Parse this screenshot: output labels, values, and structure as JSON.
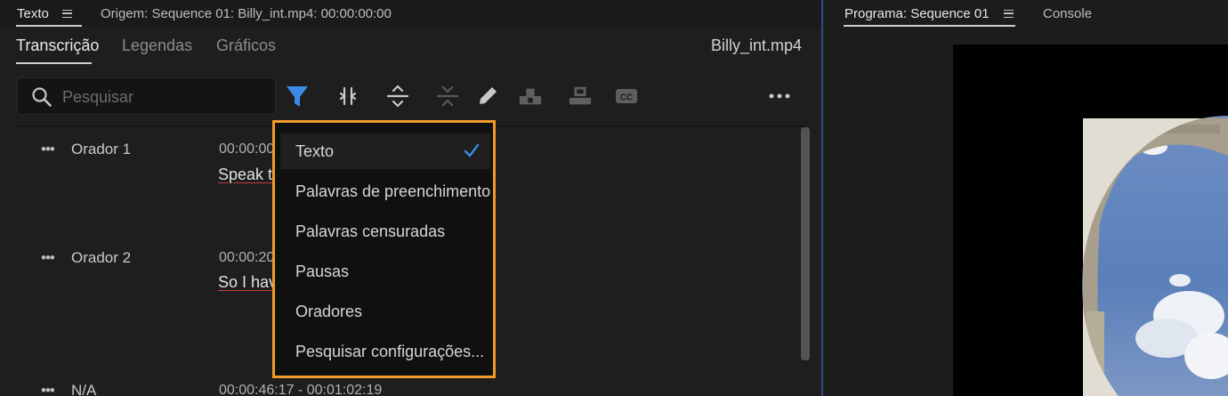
{
  "text_panel": {
    "title": "Texto",
    "source": "Origem: Sequence 01: Billy_int.mp4: 00:00:00:00",
    "tabs": [
      {
        "label": "Transcrição",
        "active": true
      },
      {
        "label": "Legendas",
        "active": false
      },
      {
        "label": "Gráficos",
        "active": false
      }
    ],
    "clip_name": "Billy_int.mp4",
    "search": {
      "placeholder": "Pesquisar",
      "value": ""
    },
    "toolbar_icons": [
      "filter-icon",
      "merge-segments-icon",
      "split-segment-icon",
      "collapse-icon",
      "edit-icon",
      "insert-icon",
      "overwrite-icon",
      "captions-icon",
      "more-options-icon"
    ],
    "rows": [
      {
        "speaker": "Orador 1",
        "timecode": "00:00:00",
        "snippet": "Speak to"
      },
      {
        "speaker": "Orador 2",
        "timecode": "00:00:20",
        "snippet": "So I have"
      },
      {
        "speaker": "N/A",
        "timecode": "00:00:46:17 - 00:01:02:19",
        "snippet": ""
      }
    ]
  },
  "filter_menu": {
    "items": [
      {
        "label": "Texto",
        "checked": true
      },
      {
        "label": "Palavras de preenchimento",
        "checked": false
      },
      {
        "label": "Palavras censuradas",
        "checked": false
      },
      {
        "label": "Pausas",
        "checked": false
      },
      {
        "label": "Oradores",
        "checked": false
      },
      {
        "label": "Pesquisar configurações...",
        "checked": false
      }
    ],
    "highlight_color": "#f09a27",
    "check_color": "#3b8be6"
  },
  "program_panel": {
    "title": "Programa: Sequence 01",
    "console_tab": "Console"
  },
  "colors": {
    "accent_blue": "#3b8be6",
    "panel_border": "#2d4f86",
    "squiggle_red": "#cc3b3b"
  }
}
